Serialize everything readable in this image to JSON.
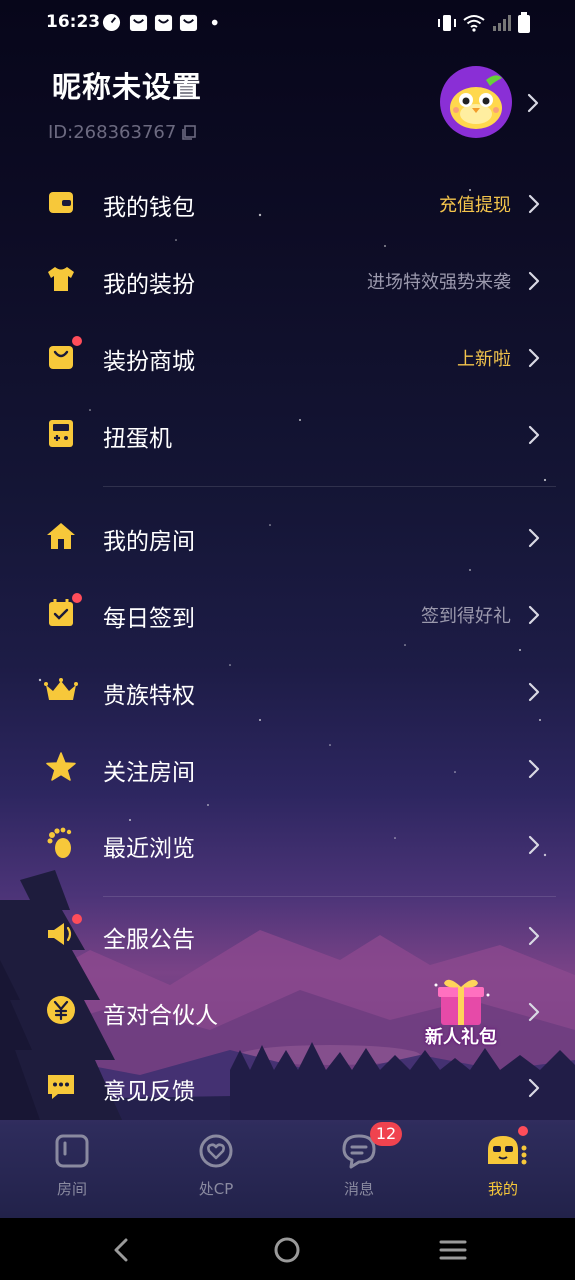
{
  "status": {
    "time": "16:23"
  },
  "profile": {
    "nickname": "昵称未设置",
    "id_text": "ID:268363767"
  },
  "menu": {
    "wallet": {
      "label": "我的钱包",
      "sub": "充值提现"
    },
    "outfit": {
      "label": "我的装扮",
      "sub": "进场特效强势来袭"
    },
    "mall": {
      "label": "装扮商城",
      "sub": "上新啦"
    },
    "gacha": {
      "label": "扭蛋机"
    },
    "room": {
      "label": "我的房间"
    },
    "checkin": {
      "label": "每日签到",
      "sub": "签到得好礼"
    },
    "noble": {
      "label": "贵族特权"
    },
    "follow": {
      "label": "关注房间"
    },
    "recent": {
      "label": "最近浏览"
    },
    "notice": {
      "label": "全服公告"
    },
    "partner": {
      "label": "音对合伙人"
    },
    "feedback": {
      "label": "意见反馈"
    }
  },
  "gift": {
    "label": "新人礼包"
  },
  "tabs": [
    {
      "label": "房间"
    },
    {
      "label": "处CP"
    },
    {
      "label": "消息",
      "badge": "12"
    },
    {
      "label": "我的"
    }
  ],
  "colors": {
    "accent": "#f7c83a",
    "badge": "#f0434f",
    "muted": "#9b99ad"
  }
}
